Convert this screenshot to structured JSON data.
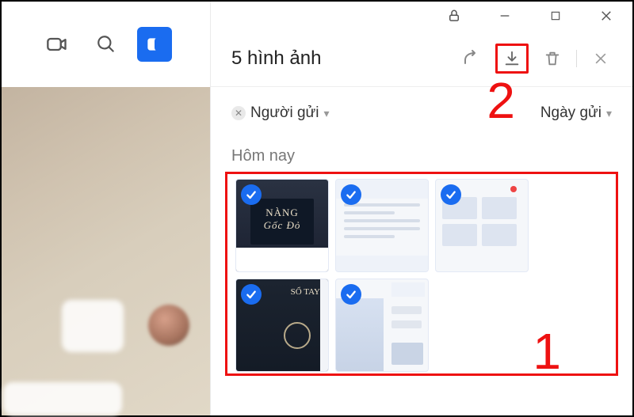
{
  "page_title": "5 hình ảnh",
  "sidebar_icons": {
    "video": "video-icon",
    "search": "search-icon",
    "switch": "panel-toggle-icon"
  },
  "window_controls": [
    "lock",
    "minimize",
    "maximize",
    "close"
  ],
  "actions": {
    "share_label": "share-icon",
    "download_label": "download-icon",
    "delete_label": "trash-icon",
    "close_label": "close-icon"
  },
  "filters": {
    "sender": "Người gửi",
    "date": "Ngày gửi"
  },
  "section": {
    "today": "Hôm nay"
  },
  "thumbs": [
    {
      "selected": true,
      "type": "book_cover_dark",
      "text_1": "NÀNG",
      "text_2": "Gốc Đỏ"
    },
    {
      "selected": true,
      "type": "article_screenshot"
    },
    {
      "selected": true,
      "type": "grid_thumbnails"
    },
    {
      "selected": true,
      "type": "book_cover_dark_2",
      "text_1": "SỔ TAY"
    },
    {
      "selected": true,
      "type": "chat_screenshot"
    }
  ],
  "annotations": {
    "step1": "1",
    "step2": "2"
  }
}
